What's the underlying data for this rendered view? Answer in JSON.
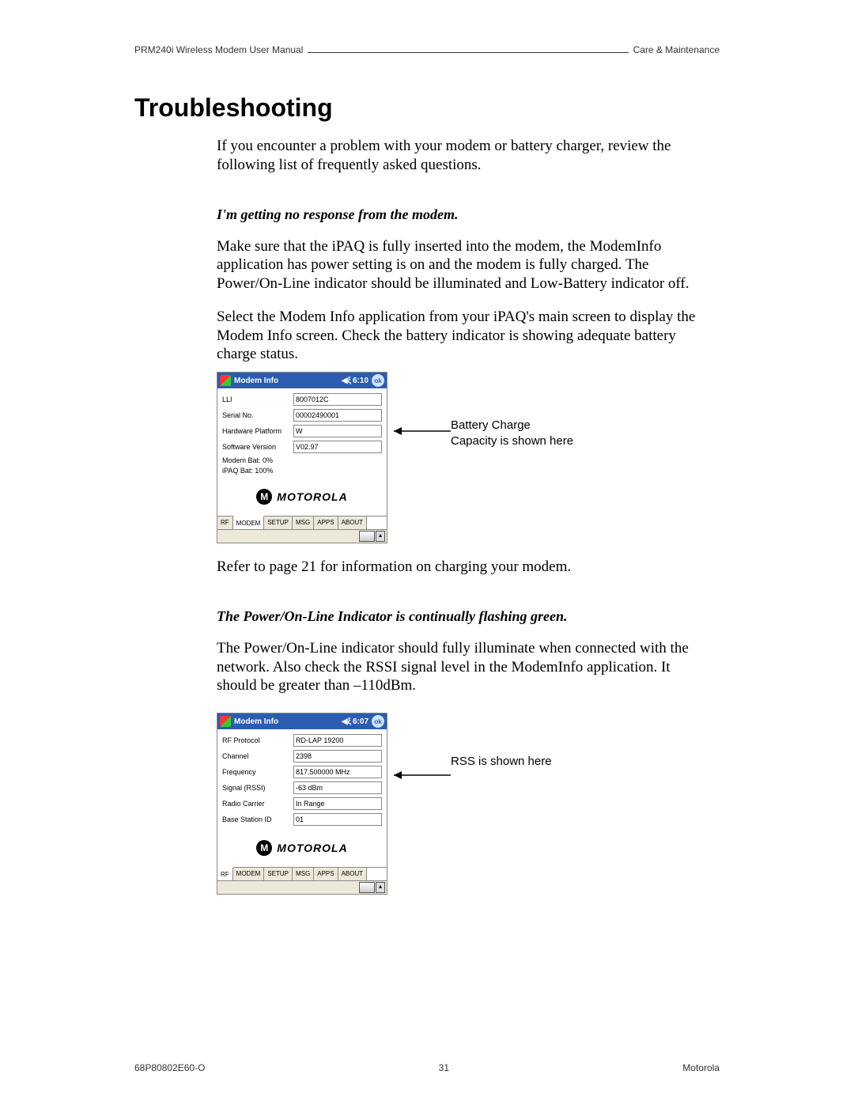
{
  "header": {
    "left": "PRM240i Wireless Modem User Manual",
    "right": "Care & Maintenance"
  },
  "title": "Troubleshooting",
  "intro": "If you encounter a problem with your modem or battery charger, review the following list of frequently asked questions.",
  "q1": {
    "heading": "I'm getting no response from the modem.",
    "p1": "Make sure that the iPAQ is fully inserted into the modem, the ModemInfo application has power setting is on and the modem is fully charged. The Power/On-Line indicator should be illuminated and Low-Battery indicator off.",
    "p2": "Select the Modem Info application from your iPAQ's main screen to display the Modem Info screen. Check the battery indicator is showing adequate battery charge status.",
    "after": "Refer to page 21 for information on charging your modem.",
    "callout": "Battery Charge Capacity is shown here"
  },
  "q2": {
    "heading": "The Power/On-Line Indicator is continually flashing green.",
    "p1": "The Power/On-Line indicator should fully illuminate when connected with the network. Also check the RSSI signal level in the ModemInfo application. It should be greater than –110dBm.",
    "callout": "RSS is shown here"
  },
  "screenshot_common": {
    "window_title": "Modem Info",
    "brand": "MOTOROLA",
    "ok": "ok",
    "speaker": "◀ξ",
    "tabs": [
      "RF",
      "MODEM",
      "SETUP",
      "MSG",
      "APPS",
      "ABOUT"
    ]
  },
  "shot1": {
    "time": "6:10",
    "fields": [
      {
        "label": "LLI",
        "value": "8007012C"
      },
      {
        "label": "Serial No.",
        "value": "00002490001"
      },
      {
        "label": "Hardware Platform",
        "value": "W"
      },
      {
        "label": "Software Version",
        "value": "V02.97"
      }
    ],
    "status": [
      "Modem Bat: 0%",
      "iPAQ Bat: 100%"
    ],
    "active_tab_index": 1
  },
  "shot2": {
    "time": "6:07",
    "fields": [
      {
        "label": "RF Protocol",
        "value": "RD-LAP 19200"
      },
      {
        "label": "Channel",
        "value": "2398"
      },
      {
        "label": "Frequency",
        "value": "817.500000 MHz"
      },
      {
        "label": "Signal (RSSI)",
        "value": "-63 dBm"
      },
      {
        "label": "Radio Carrier",
        "value": "In Range"
      },
      {
        "label": "Base Station ID",
        "value": "01"
      }
    ],
    "active_tab_index": 0
  },
  "footer": {
    "left": "68P80802E60-O",
    "center": "31",
    "right": "Motorola"
  }
}
